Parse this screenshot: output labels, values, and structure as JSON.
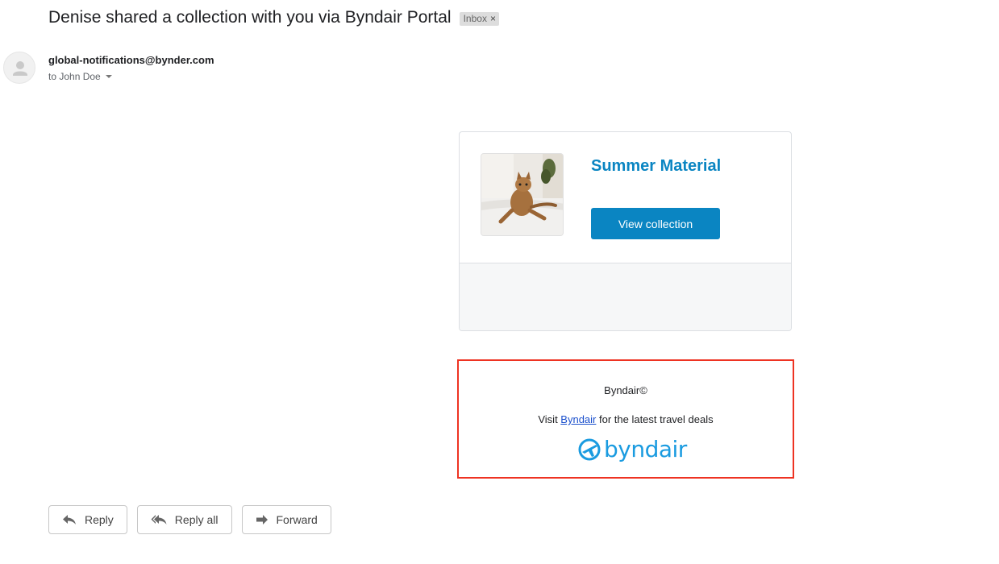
{
  "email": {
    "subject": "Denise shared a collection with you via Byndair Portal",
    "label": "Inbox",
    "label_close": "×",
    "sender": "global-notifications@bynder.com",
    "recipient_line": "to John Doe"
  },
  "card": {
    "title": "Summer Material",
    "button_label": "View collection",
    "accent_color": "#0a85c2"
  },
  "footer": {
    "copyright": "Byndair©",
    "visit_prefix": "Visit ",
    "visit_link": "Byndair",
    "visit_suffix": " for the latest travel deals",
    "logo_text": "byndair",
    "highlight_color": "#ee3322"
  },
  "actions": {
    "reply": "Reply",
    "reply_all": "Reply all",
    "forward": "Forward"
  },
  "icons": {
    "avatar": "person-icon",
    "logo": "plane-circle-icon",
    "reply": "reply-arrow-icon",
    "reply_all": "reply-all-arrow-icon",
    "forward": "forward-arrow-icon"
  }
}
